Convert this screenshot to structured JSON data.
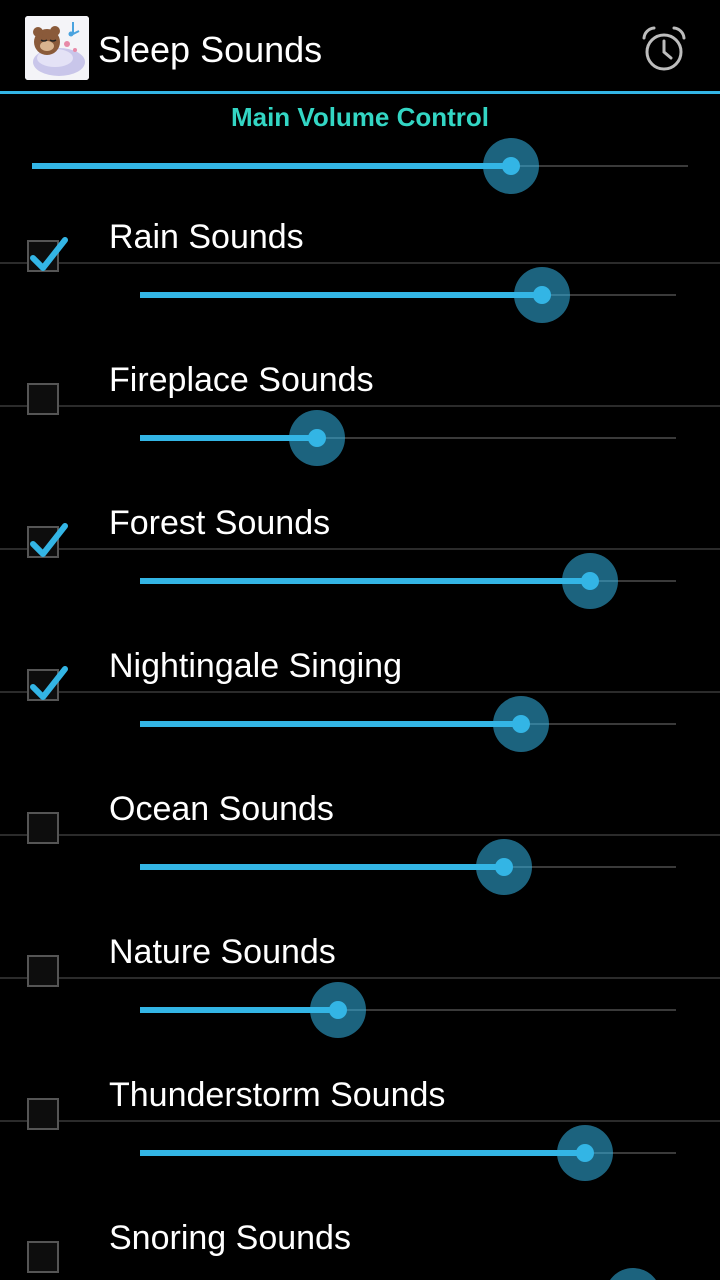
{
  "actionbar": {
    "title": "Sleep Sounds",
    "alarm_icon": "alarm-clock-icon",
    "accent": "#33b5e5"
  },
  "main_volume": {
    "label": "Main Volume Control",
    "label_color": "#33d6c4",
    "value": 0.73
  },
  "sounds": [
    {
      "label": "Rain Sounds",
      "checked": true,
      "value": 0.75
    },
    {
      "label": "Fireplace Sounds",
      "checked": false,
      "value": 0.33
    },
    {
      "label": "Forest Sounds",
      "checked": true,
      "value": 0.84
    },
    {
      "label": "Nightingale Singing",
      "checked": true,
      "value": 0.71
    },
    {
      "label": "Ocean Sounds",
      "checked": false,
      "value": 0.68
    },
    {
      "label": "Nature Sounds",
      "checked": false,
      "value": 0.37
    },
    {
      "label": "Thunderstorm Sounds",
      "checked": false,
      "value": 0.83
    },
    {
      "label": "Snoring Sounds",
      "checked": false,
      "value": 0.92
    }
  ]
}
